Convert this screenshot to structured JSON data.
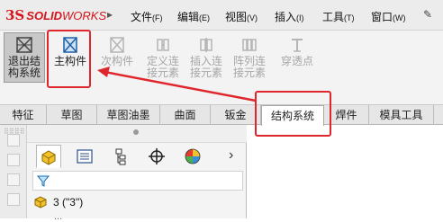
{
  "app": {
    "logo_ds": "3S",
    "logo_solid": "SOLID",
    "logo_works": "WORKS",
    "logo_arrow": "▸"
  },
  "menu": [
    {
      "label": "文件",
      "accel": "(F)"
    },
    {
      "label": "编辑",
      "accel": "(E)"
    },
    {
      "label": "视图",
      "accel": "(V)"
    },
    {
      "label": "插入",
      "accel": "(I)"
    },
    {
      "label": "工具",
      "accel": "(T)"
    },
    {
      "label": "窗口",
      "accel": "(W)"
    }
  ],
  "pin_glyph": "✎",
  "ribbon": {
    "exit_label": "退出结构系统",
    "main_label": "主构件",
    "sub_label": "次构件",
    "define_label": "定义连接元素",
    "insert_label": "插入连接元素",
    "array_label": "阵列连接元素",
    "pierce_label": "穿透点"
  },
  "tabs": [
    "特征",
    "草图",
    "草图油墨",
    "曲面",
    "钣金",
    "结构系统",
    "焊件",
    "模具工具"
  ],
  "active_tab": "结构系统",
  "panel": {
    "tabs_more": "›",
    "tree_item": "3 (\"3\")",
    "tree_sub": "..."
  },
  "colors": {
    "highlight": "#e0262d",
    "brand": "#d7141a"
  }
}
